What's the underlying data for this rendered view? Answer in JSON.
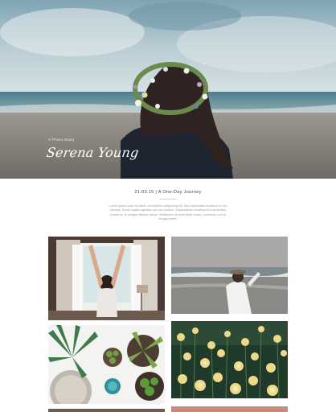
{
  "hero": {
    "kicker": "A Photo Diary",
    "name": "Serena Young"
  },
  "intro": {
    "date_title": "21.03.15 | A One-Day Journey",
    "body": "Lorem ipsum dolor sit amet, consectetur adipiscing elit. Sed malesuada faucibus ex nec ultricies. Donec mattis egestas nisi non pretium. Suspendisse maximus id erat facilisis maximus. In congue efficitur varius. Vestibulum sit amet felis ornare, commodo orci ut feugiat lorem."
  },
  "gallery": {
    "photos": [
      {
        "icon": "window-photo"
      },
      {
        "icon": "beach-photo"
      },
      {
        "icon": "succulents-photo"
      },
      {
        "icon": "flowers-photo"
      }
    ]
  },
  "colors": {
    "sky": "#8fb0bf",
    "sea": "#5f8a96",
    "sand": "#8f8a84",
    "text_muted": "#999999"
  }
}
